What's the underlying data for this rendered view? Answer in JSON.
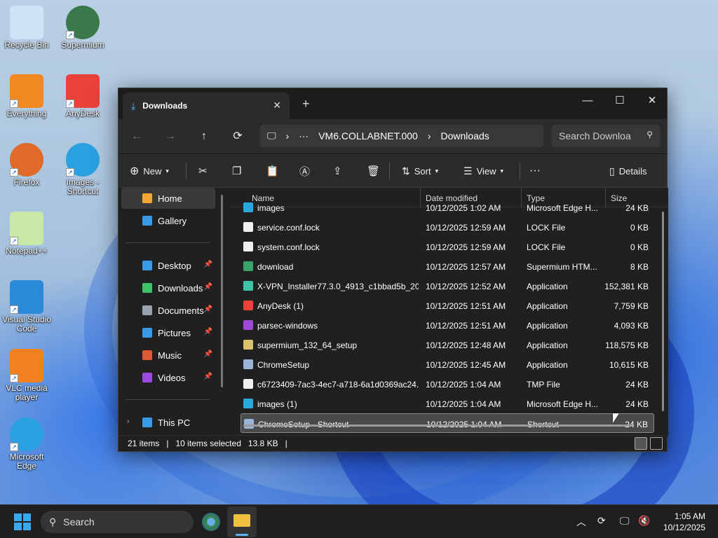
{
  "desktop": {
    "icons": [
      {
        "label": "Recycle Bin",
        "icon": "recycle-bin-icon"
      },
      {
        "label": "Supermium",
        "icon": "supermium-icon"
      },
      {
        "label": "Everything",
        "icon": "everything-search-icon"
      },
      {
        "label": "AnyDesk",
        "icon": "anydesk-icon"
      },
      {
        "label": "Firefox",
        "icon": "firefox-icon"
      },
      {
        "label": "Images - Shortcut",
        "icon": "edge-icon"
      },
      {
        "label": "Notepad++",
        "icon": "notepadpp-icon"
      },
      {
        "label": "Visual Studio Code",
        "icon": "vscode-icon"
      },
      {
        "label": "VLC media player",
        "icon": "vlc-icon"
      },
      {
        "label": "Microsoft Edge",
        "icon": "edge-icon"
      }
    ]
  },
  "window": {
    "tab_title": "Downloads",
    "new_tab": "+",
    "controls": {
      "minimize": "—",
      "maximize": "☐",
      "close": "✕"
    }
  },
  "nav": {
    "back": "←",
    "forward": "→",
    "up": "↑",
    "refresh": "⟳",
    "address": {
      "ellipsis": "···",
      "segment1": "VM6.COLLABNET.000",
      "segment2": "Downloads"
    },
    "search_placeholder": "Search Downloa"
  },
  "toolbar": {
    "new_label": "New",
    "sort_label": "Sort",
    "view_label": "View",
    "more_label": "···",
    "details_label": "Details"
  },
  "sidebar": {
    "home": "Home",
    "gallery": "Gallery",
    "quick": [
      {
        "label": "Desktop",
        "color": "#3a9ae8"
      },
      {
        "label": "Downloads",
        "color": "#3ec36b"
      },
      {
        "label": "Documents",
        "color": "#9aa3b0"
      },
      {
        "label": "Pictures",
        "color": "#3a9ae8"
      },
      {
        "label": "Music",
        "color": "#e05a3a"
      },
      {
        "label": "Videos",
        "color": "#9a4ae0"
      }
    ],
    "this_pc": "This PC"
  },
  "columns": {
    "name": "Name",
    "date": "Date modified",
    "type": "Type",
    "size": "Size"
  },
  "files": [
    {
      "name": "images",
      "date": "10/12/2025 1:02 AM",
      "type": "Microsoft Edge H...",
      "size": "24 KB",
      "color": "#2aa9e0"
    },
    {
      "name": "service.conf.lock",
      "date": "10/12/2025 12:59 AM",
      "type": "LOCK File",
      "size": "0 KB",
      "color": "#f0f0f0"
    },
    {
      "name": "system.conf.lock",
      "date": "10/12/2025 12:59 AM",
      "type": "LOCK File",
      "size": "0 KB",
      "color": "#f0f0f0"
    },
    {
      "name": "download",
      "date": "10/12/2025 12:57 AM",
      "type": "Supermium HTM...",
      "size": "8 KB",
      "color": "#3aa56a"
    },
    {
      "name": "X-VPN_Installer77.3.0_4913_c1bbad5b_20...",
      "date": "10/12/2025 12:52 AM",
      "type": "Application",
      "size": "152,381 KB",
      "color": "#3cc6a8"
    },
    {
      "name": "AnyDesk (1)",
      "date": "10/12/2025 12:51 AM",
      "type": "Application",
      "size": "7,759 KB",
      "color": "#e8423a"
    },
    {
      "name": "parsec-windows",
      "date": "10/12/2025 12:51 AM",
      "type": "Application",
      "size": "4,093 KB",
      "color": "#a24ad8"
    },
    {
      "name": "supermium_132_64_setup",
      "date": "10/12/2025 12:48 AM",
      "type": "Application",
      "size": "118,575 KB",
      "color": "#d8c26a"
    },
    {
      "name": "ChromeSetup",
      "date": "10/12/2025 12:45 AM",
      "type": "Application",
      "size": "10,615 KB",
      "color": "#9ab4d8"
    },
    {
      "name": "c6723409-7ac3-4ec7-a718-6a1d0369ac24....",
      "date": "10/12/2025 1:04 AM",
      "type": "TMP File",
      "size": "24 KB",
      "color": "#f0f0f0"
    },
    {
      "name": "images (1)",
      "date": "10/12/2025 1:04 AM",
      "type": "Microsoft Edge H...",
      "size": "24 KB",
      "color": "#2aa9e0"
    },
    {
      "name": "ChromeSetup - Shortcut",
      "date": "10/12/2025 1:04 AM",
      "type": "Shortcut",
      "size": "24 KB",
      "color": "#9ab4d8"
    }
  ],
  "status": {
    "count": "21 items",
    "selected": "10 items selected",
    "size": "13.8 KB"
  },
  "taskbar": {
    "search_placeholder": "Search",
    "time": "1:05 AM",
    "date": "10/12/2025"
  }
}
